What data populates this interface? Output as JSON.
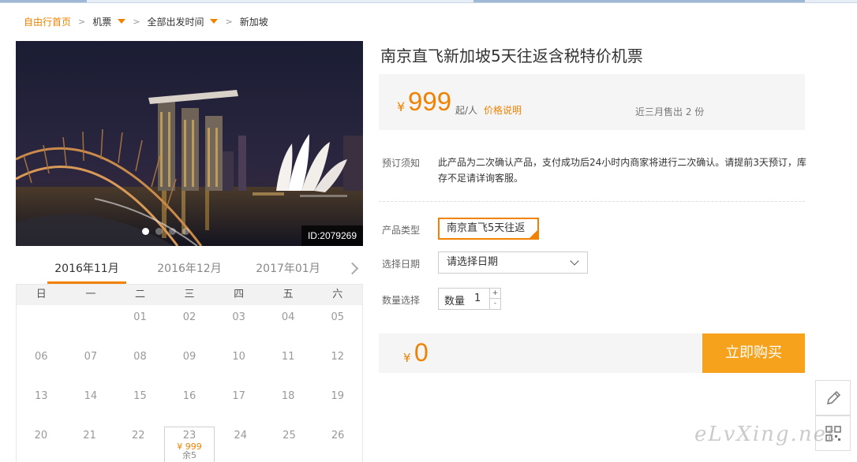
{
  "breadcrumb": {
    "home": "自由行首页",
    "flights": "机票",
    "departure": "全部出发时间",
    "destination": "新加坡"
  },
  "photo": {
    "id_label": "ID:2079269",
    "slides": 4,
    "active_slide": 1
  },
  "calendar": {
    "months": [
      "2016年11月",
      "2016年12月",
      "2017年01月"
    ],
    "active_month": 0,
    "weekdays": [
      "日",
      "一",
      "二",
      "三",
      "四",
      "五",
      "六"
    ],
    "rows": [
      [
        "",
        "",
        "01",
        "02",
        "03",
        "04",
        "05"
      ],
      [
        "06",
        "07",
        "08",
        "09",
        "10",
        "11",
        "12"
      ],
      [
        "13",
        "14",
        "15",
        "16",
        "17",
        "18",
        "19"
      ],
      [
        "20",
        "21",
        "22",
        "23",
        "24",
        "25",
        "26"
      ]
    ],
    "highlight": {
      "day": "23",
      "price": "¥ 999",
      "remaining": "余5"
    }
  },
  "product": {
    "title": "南京直飞新加坡5天往返含税特价机票",
    "currency": "¥",
    "price": "999",
    "price_unit": "起/人",
    "price_note": "价格说明",
    "sold": "近三月售出 2 份",
    "notice_label": "预订须知",
    "notice_text": "此产品为二次确认产品，支付成功后24小时内商家将进行二次确认。请提前3天预订，库存不足请详询客服。",
    "type_label": "产品类型",
    "type_value": "南京直飞5天往返",
    "date_label": "选择日期",
    "date_placeholder": "请选择日期",
    "qty_label": "数量选择",
    "qty_inner_label": "数量",
    "qty_value": "1",
    "qty_plus": "+",
    "qty_minus": "-",
    "total_currency": "¥",
    "total": "0",
    "buy_label": "立即购买"
  },
  "watermark": "eLvXing.net",
  "colors": {
    "accent": "#f08200",
    "buy_button": "#f6a21d"
  }
}
